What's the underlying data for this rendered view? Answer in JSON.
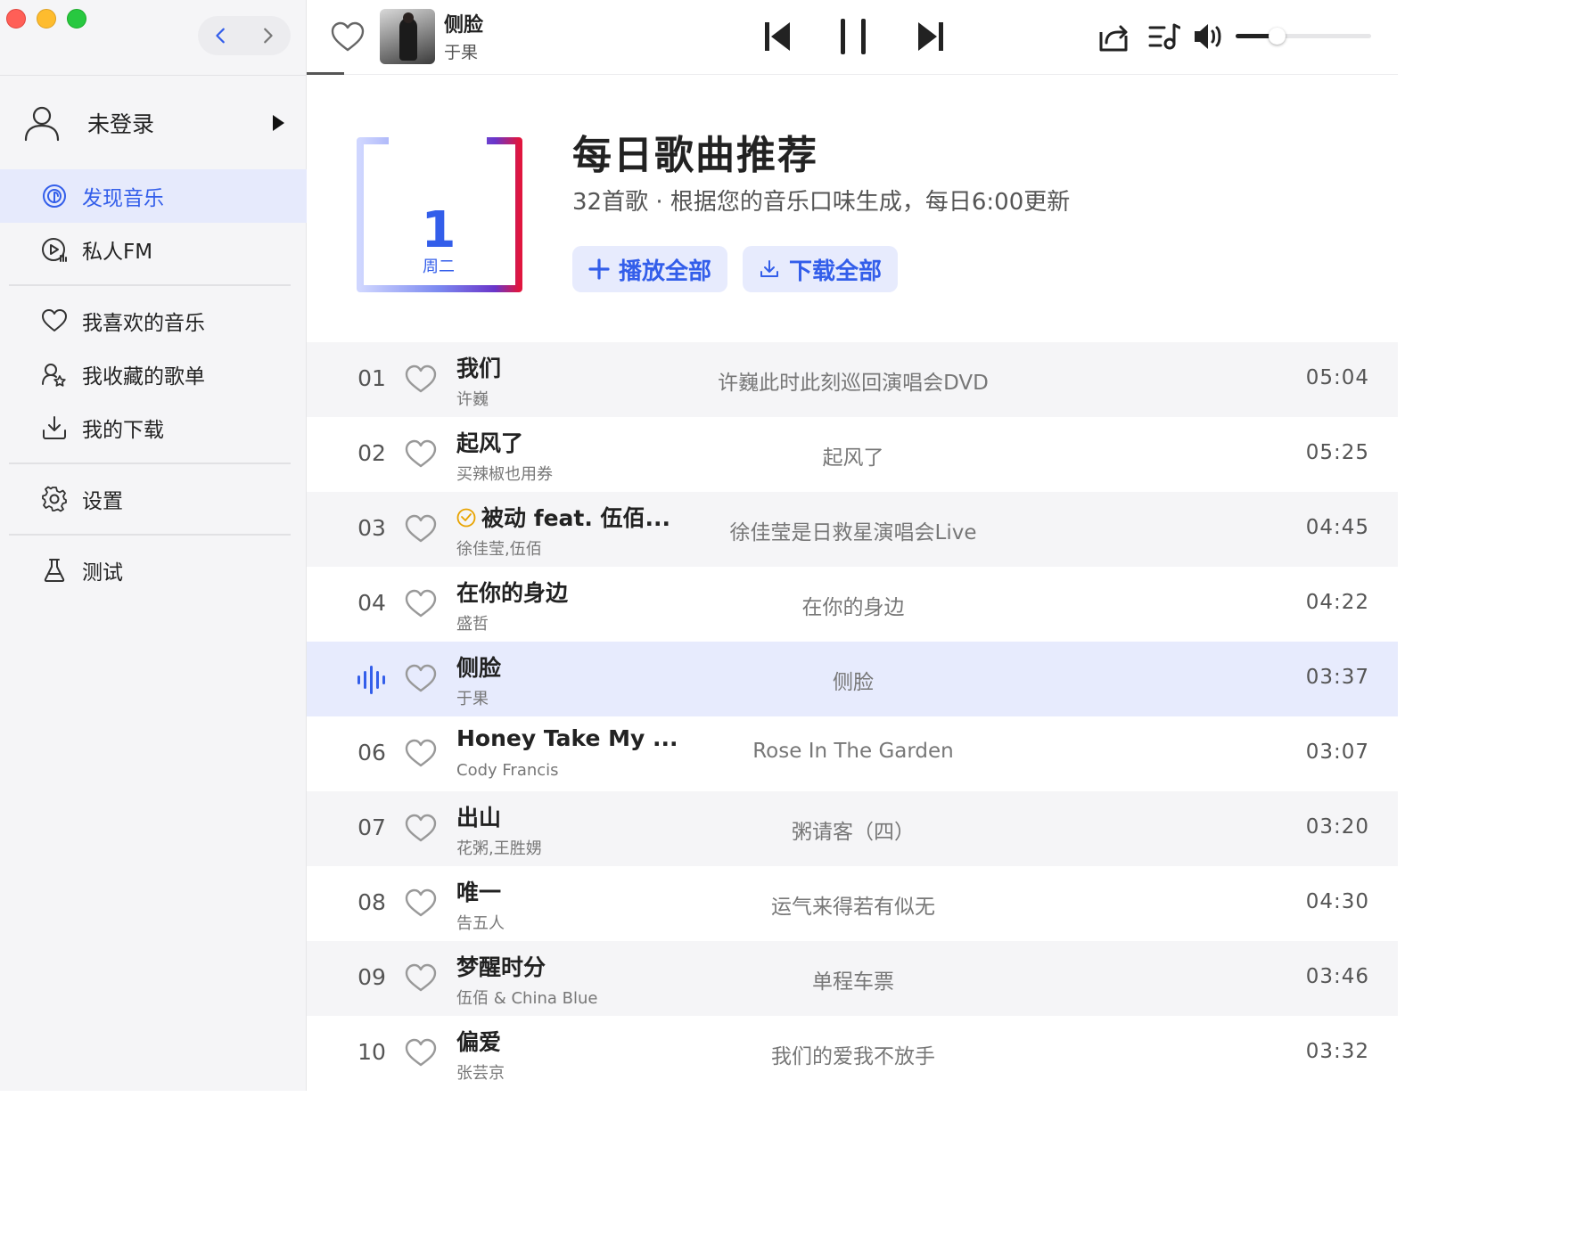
{
  "sidebar": {
    "user": {
      "name": "未登录"
    },
    "items": [
      {
        "id": "discover",
        "label": "发现音乐",
        "active": true
      },
      {
        "id": "fm",
        "label": "私人FM",
        "active": false
      },
      {
        "id": "liked",
        "label": "我喜欢的音乐",
        "active": false
      },
      {
        "id": "playlists",
        "label": "我收藏的歌单",
        "active": false
      },
      {
        "id": "downloads",
        "label": "我的下载",
        "active": false
      },
      {
        "id": "settings",
        "label": "设置",
        "active": false
      },
      {
        "id": "test",
        "label": "测试",
        "active": false
      }
    ]
  },
  "player": {
    "title": "侧脸",
    "artist": "于果",
    "volume": 0.3
  },
  "header": {
    "calendar_day": "1",
    "calendar_week": "周二",
    "title": "每日歌曲推荐",
    "subtitle": "32首歌 · 根据您的音乐口味生成，每日6:00更新",
    "play_all": "播放全部",
    "download_all": "下载全部"
  },
  "colors": {
    "accent": "#335eea",
    "active_bg": "#e7ebfd",
    "stripe": "#f5f5f7"
  },
  "tracks": [
    {
      "num": "01",
      "title": "我们",
      "artist": "许巍",
      "album": "许巍此时此刻巡回演唱会DVD",
      "duration": "05:04"
    },
    {
      "num": "02",
      "title": "起风了",
      "artist": "买辣椒也用券",
      "album": "起风了",
      "duration": "05:25"
    },
    {
      "num": "03",
      "title": "被动 feat. 伍佰...",
      "artist": "徐佳莹,伍佰",
      "album": "徐佳莹是日救星演唱会Live",
      "duration": "04:45",
      "badge": true
    },
    {
      "num": "04",
      "title": "在你的身边",
      "artist": "盛哲",
      "album": "在你的身边",
      "duration": "04:22"
    },
    {
      "num": "05",
      "title": "侧脸",
      "artist": "于果",
      "album": "侧脸",
      "duration": "03:37",
      "playing": true
    },
    {
      "num": "06",
      "title": "Honey Take My ...",
      "artist": "Cody Francis",
      "album": "Rose In The Garden",
      "duration": "03:07"
    },
    {
      "num": "07",
      "title": "出山",
      "artist": "花粥,王胜娚",
      "album": "粥请客（四）",
      "duration": "03:20"
    },
    {
      "num": "08",
      "title": "唯一",
      "artist": "告五人",
      "album": "运气来得若有似无",
      "duration": "04:30"
    },
    {
      "num": "09",
      "title": "梦醒时分",
      "artist": "伍佰 & China Blue",
      "album": "单程车票",
      "duration": "03:46"
    },
    {
      "num": "10",
      "title": "偏爱",
      "artist": "张芸京",
      "album": "我们的爱我不放手",
      "duration": "03:32"
    }
  ]
}
